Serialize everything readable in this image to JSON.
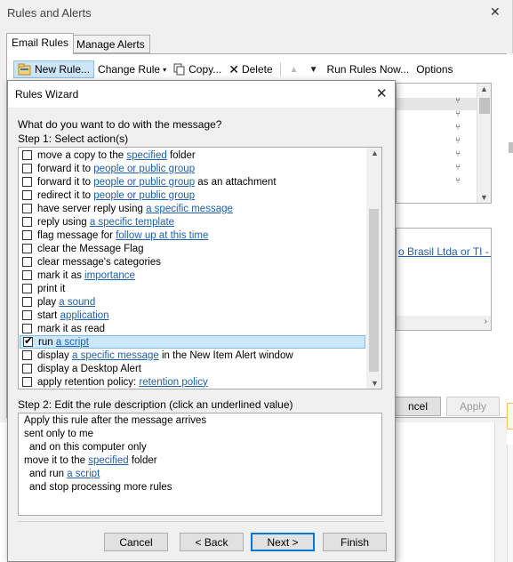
{
  "background_window": {
    "title": "Rules and Alerts",
    "close_glyph": "✕",
    "tabs": [
      {
        "label": "Email Rules"
      },
      {
        "label": "Manage Alerts"
      }
    ],
    "toolbar": {
      "new_rule": "New Rule...",
      "change_rule": "Change Rule",
      "copy": "Copy...",
      "delete": "Delete",
      "run_rules_now": "Run Rules Now...",
      "options": "Options"
    },
    "description_link_fragment": "o Brasil Ltda or TI - Pe",
    "buttons": {
      "cancel_fragment": "ncel",
      "apply": "Apply"
    }
  },
  "wizard": {
    "title": "Rules Wizard",
    "close_glyph": "✕",
    "question": "What do you want to do with the message?",
    "step1_label": "Step 1: Select action(s)",
    "step2_label": "Step 2: Edit the rule description (click an underlined value)",
    "actions": [
      {
        "pre": "move a copy to the ",
        "link": "specified",
        "post": " folder",
        "checked": false
      },
      {
        "pre": "forward it to ",
        "link": "people or public group",
        "post": "",
        "checked": false
      },
      {
        "pre": "forward it to ",
        "link": "people or public group",
        "post": " as an attachment",
        "checked": false
      },
      {
        "pre": "redirect it to ",
        "link": "people or public group",
        "post": "",
        "checked": false
      },
      {
        "pre": "have server reply using ",
        "link": "a specific message",
        "post": "",
        "checked": false
      },
      {
        "pre": "reply using ",
        "link": "a specific template",
        "post": "",
        "checked": false
      },
      {
        "pre": "flag message for ",
        "link": "follow up at this time",
        "post": "",
        "checked": false
      },
      {
        "pre": "clear the Message Flag",
        "link": "",
        "post": "",
        "checked": false
      },
      {
        "pre": "clear message's categories",
        "link": "",
        "post": "",
        "checked": false
      },
      {
        "pre": "mark it as ",
        "link": "importance",
        "post": "",
        "checked": false
      },
      {
        "pre": "print it",
        "link": "",
        "post": "",
        "checked": false
      },
      {
        "pre": "play ",
        "link": "a sound",
        "post": "",
        "checked": false
      },
      {
        "pre": "start ",
        "link": "application",
        "post": "",
        "checked": false
      },
      {
        "pre": "mark it as read",
        "link": "",
        "post": "",
        "checked": false
      },
      {
        "pre": "run ",
        "link": "a script",
        "post": "",
        "checked": true
      },
      {
        "pre": "display ",
        "link": "a specific message",
        "post": " in the New Item Alert window",
        "checked": false
      },
      {
        "pre": "display a Desktop Alert",
        "link": "",
        "post": "",
        "checked": false
      },
      {
        "pre": "apply retention policy: ",
        "link": "retention policy",
        "post": "",
        "checked": false
      }
    ],
    "description": [
      {
        "pre": "Apply this rule after the message arrives",
        "link": "",
        "post": "",
        "indent": false
      },
      {
        "pre": "sent only to me",
        "link": "",
        "post": "",
        "indent": false
      },
      {
        "pre": "and on this computer only",
        "link": "",
        "post": "",
        "indent": true
      },
      {
        "pre": "move it to the ",
        "link": "specified",
        "post": " folder",
        "indent": false
      },
      {
        "pre": "and run ",
        "link": "a script",
        "post": "",
        "indent": true
      },
      {
        "pre": "and stop processing more rules",
        "link": "",
        "post": "",
        "indent": true
      }
    ],
    "buttons": {
      "cancel": "Cancel",
      "back": "< Back",
      "next": "Next >",
      "finish": "Finish"
    }
  }
}
